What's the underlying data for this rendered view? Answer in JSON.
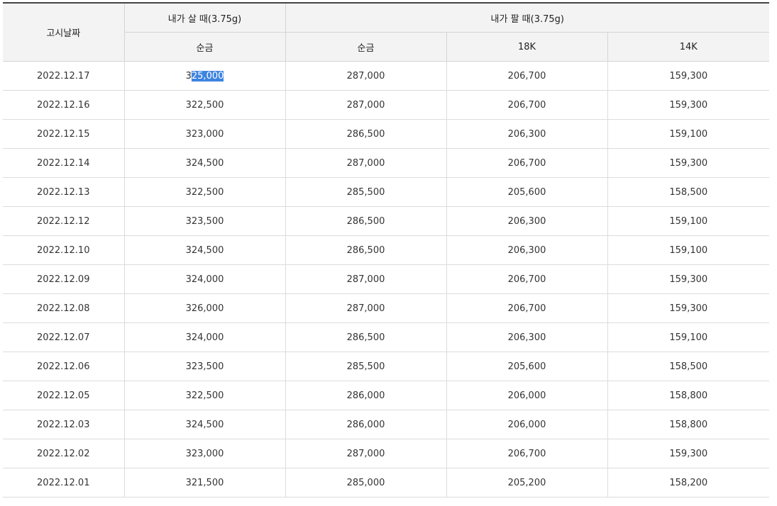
{
  "table": {
    "header": {
      "date": "고시날짜",
      "buy_group": "내가 살 때(3.75g)",
      "sell_group": "내가 팔 때(3.75g)",
      "buy_sub": [
        "순금"
      ],
      "sell_sub": [
        "순금",
        "18K",
        "14K"
      ]
    },
    "rows": [
      {
        "date": "2022.12.17",
        "buy": "325,000",
        "buy_pre": "3",
        "buy_sel": "25,000",
        "sell_pure": "287,000",
        "sell_18k": "206,700",
        "sell_14k": "159,300"
      },
      {
        "date": "2022.12.16",
        "buy": "322,500",
        "sell_pure": "287,000",
        "sell_18k": "206,700",
        "sell_14k": "159,300"
      },
      {
        "date": "2022.12.15",
        "buy": "323,000",
        "sell_pure": "286,500",
        "sell_18k": "206,300",
        "sell_14k": "159,100"
      },
      {
        "date": "2022.12.14",
        "buy": "324,500",
        "sell_pure": "287,000",
        "sell_18k": "206,700",
        "sell_14k": "159,300"
      },
      {
        "date": "2022.12.13",
        "buy": "322,500",
        "sell_pure": "285,500",
        "sell_18k": "205,600",
        "sell_14k": "158,500"
      },
      {
        "date": "2022.12.12",
        "buy": "323,500",
        "sell_pure": "286,500",
        "sell_18k": "206,300",
        "sell_14k": "159,100"
      },
      {
        "date": "2022.12.10",
        "buy": "324,500",
        "sell_pure": "286,500",
        "sell_18k": "206,300",
        "sell_14k": "159,100"
      },
      {
        "date": "2022.12.09",
        "buy": "324,000",
        "sell_pure": "287,000",
        "sell_18k": "206,700",
        "sell_14k": "159,300"
      },
      {
        "date": "2022.12.08",
        "buy": "326,000",
        "sell_pure": "287,000",
        "sell_18k": "206,700",
        "sell_14k": "159,300"
      },
      {
        "date": "2022.12.07",
        "buy": "324,000",
        "sell_pure": "286,500",
        "sell_18k": "206,300",
        "sell_14k": "159,100"
      },
      {
        "date": "2022.12.06",
        "buy": "323,500",
        "sell_pure": "285,500",
        "sell_18k": "205,600",
        "sell_14k": "158,500"
      },
      {
        "date": "2022.12.05",
        "buy": "322,500",
        "sell_pure": "286,000",
        "sell_18k": "206,000",
        "sell_14k": "158,800"
      },
      {
        "date": "2022.12.03",
        "buy": "324,500",
        "sell_pure": "286,000",
        "sell_18k": "206,000",
        "sell_14k": "158,800"
      },
      {
        "date": "2022.12.02",
        "buy": "323,000",
        "sell_pure": "287,000",
        "sell_18k": "206,700",
        "sell_14k": "159,300"
      },
      {
        "date": "2022.12.01",
        "buy": "321,500",
        "sell_pure": "285,000",
        "sell_18k": "205,200",
        "sell_14k": "158,200"
      }
    ]
  },
  "colors": {
    "selection_bg": "#3d84e0",
    "header_bg": "#f3f3f3",
    "top_border": "#444444"
  }
}
